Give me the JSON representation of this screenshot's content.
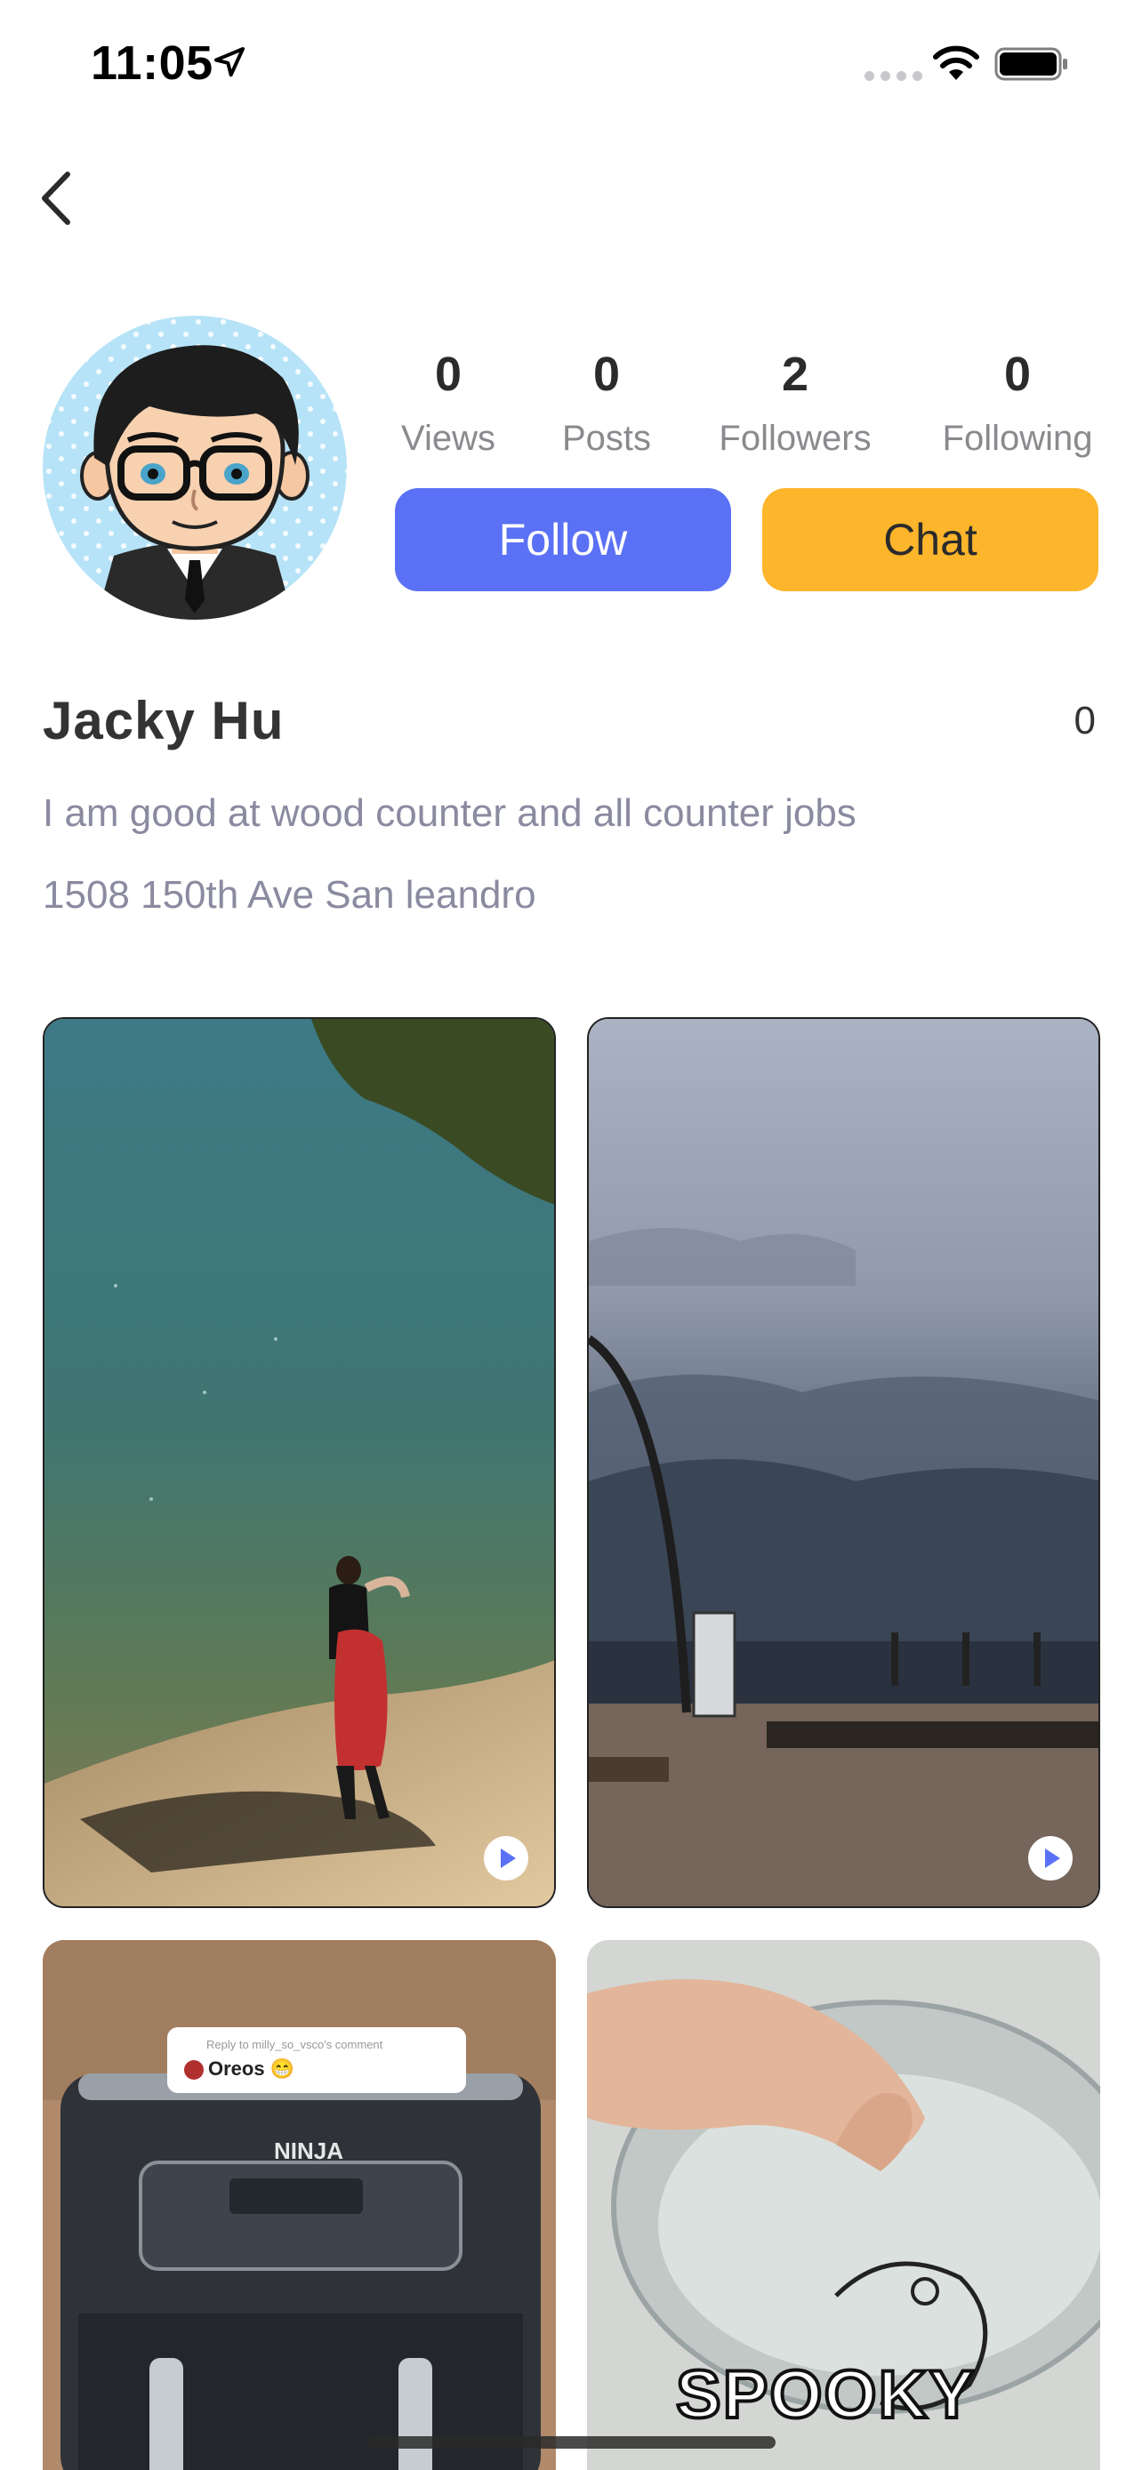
{
  "status_bar": {
    "time": "11:05",
    "icons": [
      "location-arrow-icon",
      "signal-icon",
      "wifi-icon",
      "battery-icon"
    ]
  },
  "nav": {
    "back_icon": "chevron-left-icon"
  },
  "profile": {
    "avatar": "cartoon-avatar",
    "stats": [
      {
        "value": "0",
        "label": "Views"
      },
      {
        "value": "0",
        "label": "Posts"
      },
      {
        "value": "2",
        "label": "Followers"
      },
      {
        "value": "0",
        "label": "Following"
      }
    ],
    "follow_label": "Follow",
    "chat_label": "Chat",
    "name": "Jacky Hu",
    "side_count": "0",
    "bio": "I am good at wood counter and all counter jobs",
    "address": "1508 150th Ave San leandro"
  },
  "grid": {
    "tiles": [
      {
        "kind": "video",
        "scene": "man-at-lake-shore"
      },
      {
        "kind": "video",
        "scene": "stormy-pier"
      },
      {
        "kind": "image",
        "scene": "air-fryer",
        "comment_header": "Reply to milly_so_vsco's comment",
        "comment_text": "Oreos 😁",
        "brand": "NINJA"
      },
      {
        "kind": "image",
        "scene": "glass-bowl",
        "caption": "SPOOKY"
      }
    ]
  },
  "colors": {
    "follow": "#5b71f5",
    "chat": "#fdb52b",
    "secondary_text": "#8a8aa0"
  }
}
